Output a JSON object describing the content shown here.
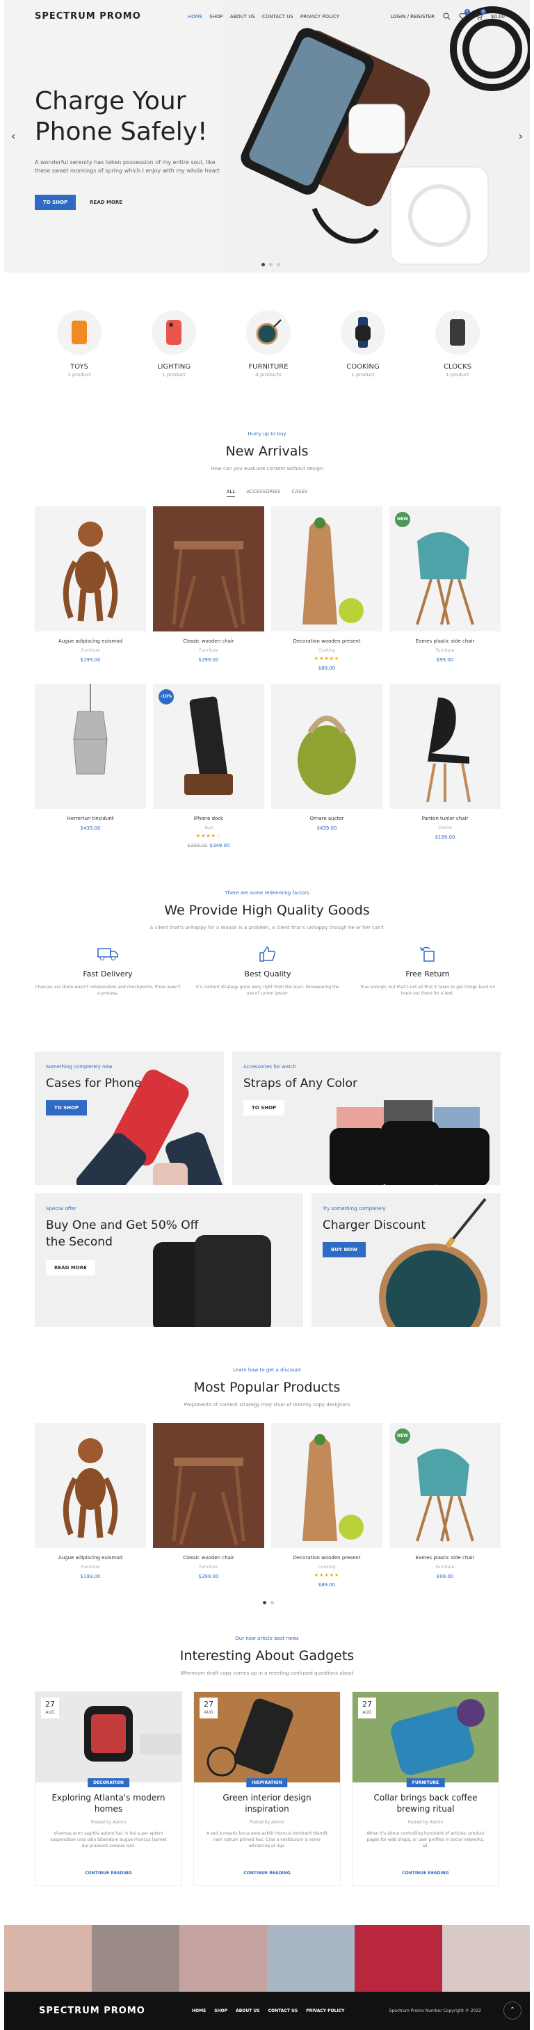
{
  "header": {
    "logo": "SPECTRUM PROMO",
    "nav": [
      "HOME",
      "SHOP",
      "ABOUT US",
      "CONTACT US",
      "PRIVACY POLICY"
    ],
    "login": "LOGIN / REGISTER",
    "wishlist_count": "0",
    "cart_count": "0",
    "cart_total": "$0.00"
  },
  "hero": {
    "title": "Charge Your Phone Safely!",
    "subtitle": "A wonderful serenity has taken possession of my entire soul, like these sweet mornings of spring which I enjoy with my whole heart",
    "btn_shop": "TO SHOP",
    "btn_more": "READ MORE"
  },
  "categories": [
    {
      "name": "TOYS",
      "count": "1 product"
    },
    {
      "name": "LIGHTING",
      "count": "1 product"
    },
    {
      "name": "FURNITURE",
      "count": "4 products"
    },
    {
      "name": "COOKING",
      "count": "1 product"
    },
    {
      "name": "CLOCKS",
      "count": "1 product"
    }
  ],
  "arrivals": {
    "pre": "Hurry up to buy",
    "title": "New Arrivals",
    "sub": "How can you evaluate content without design",
    "tabs": [
      "ALL",
      "ACCESSORIES",
      "CASES"
    ],
    "products": [
      {
        "name": "Augue adipiscing euismod",
        "cat": "Furniture",
        "price": "$199.00"
      },
      {
        "name": "Classic wooden chair",
        "cat": "Furniture",
        "price": "$299.00"
      },
      {
        "name": "Decoration wooden present",
        "cat": "Cooking",
        "stars": "★★★★★",
        "price": "$89.00"
      },
      {
        "name": "Eames plastic side chair",
        "cat": "Furniture",
        "price": "$99.00",
        "tag": "NEW"
      },
      {
        "name": "Herrertun tincidunt",
        "cat": "",
        "price": "$439.00"
      },
      {
        "name": "iPhone dock",
        "cat": "Toys",
        "stars": "★★★★☆",
        "old": "$389.00",
        "price": "$349.00",
        "tag": "-10%"
      },
      {
        "name": "Ornare auctor",
        "cat": "",
        "price": "$439.00"
      },
      {
        "name": "Panton tunior chair",
        "cat": "Clocks",
        "price": "$199.00"
      }
    ]
  },
  "quality": {
    "pre": "There are some redeeming factors",
    "title": "We Provide High Quality Goods",
    "sub": "A client that's unhappy for a reason is a problem, a client that's unhappy though he or her can't",
    "features": [
      {
        "title": "Fast Delivery",
        "desc": "Chances are there wasn't collaboration and checkpoints, there wasn't a process."
      },
      {
        "title": "Best Quality",
        "desc": "It's content strategy gone awry right from the start. Forswearing the use of Lorem Ipsum."
      },
      {
        "title": "Free Return",
        "desc": "True enough, but that's not all that it takes to get things back on track out there for a text."
      }
    ]
  },
  "promos": [
    {
      "pre": "Something completely new",
      "title": "Cases for Phone",
      "btn": "TO SHOP"
    },
    {
      "pre": "Accessories for watch",
      "title": "Straps of Any Color",
      "btn": "TO SHOP"
    },
    {
      "pre": "Special offer",
      "title": "Buy One and Get 50% Off the Second",
      "btn": "READ MORE"
    },
    {
      "pre": "Try something completely",
      "title": "Charger Discount",
      "btn": "BUY NOW"
    }
  ],
  "popular": {
    "pre": "Learn how to get a discount",
    "title": "Most Popular Products",
    "sub": "Proponents of content strategy may shun of dummy copy designers",
    "products": [
      {
        "name": "Augue adipiscing euismod",
        "cat": "Furniture",
        "price": "$199.00"
      },
      {
        "name": "Classic wooden chair",
        "cat": "Furniture",
        "price": "$299.00"
      },
      {
        "name": "Decoration wooden present",
        "cat": "Cooking",
        "stars": "★★★★★",
        "price": "$89.00"
      },
      {
        "name": "Eames plastic side chair",
        "cat": "Furniture",
        "price": "$99.00",
        "tag": "NEW"
      }
    ]
  },
  "blog": {
    "pre": "Our new article best news",
    "title": "Interesting About Gadgets",
    "sub": "Whenever draft copy comes up in a meeting confused questions about",
    "posts": [
      {
        "day": "27",
        "month": "AUG",
        "tag": "DECORATION",
        "title": "Exploring Atlanta's modern homes",
        "meta": "Posted by  Admin",
        "desc": "Vivamus acon sagittis aptent hac in dui a per aptent suspendisse cras odio bibendum augue rhoncus laoreet dui praesent sodales sed.",
        "more": "CONTINUE READING"
      },
      {
        "day": "27",
        "month": "AUG",
        "tag": "INSPIRATION",
        "title": "Green interior design inspiration",
        "meta": "Posted by  Admin",
        "desc": "A sed a mauris lucus ante ackth rhoncus hendrerit blandit nam rutrum primed hac. Cras a vestibulum a nenor witrascing et lige.",
        "more": "CONTINUE READING"
      },
      {
        "day": "27",
        "month": "AUG",
        "tag": "FURNITURE",
        "title": "Collar brings back coffee brewing ritual",
        "meta": "Posted by  Admin",
        "desc": "When it's about controlling hundreds of articles, product pages for web shops, or user profiles in social networks, all.",
        "more": "CONTINUE READING"
      }
    ]
  },
  "footer": {
    "logo": "SPECTRUM PROMO",
    "nav": [
      "HOME",
      "SHOP",
      "ABOUT US",
      "CONTACT US",
      "PRIVACY POLICY"
    ],
    "copyright": "Spectrum Promo Number Copyright © 2022"
  }
}
